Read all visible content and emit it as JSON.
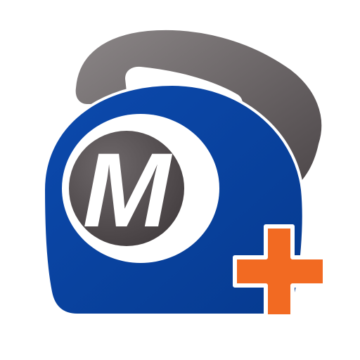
{
  "app_icon": {
    "name": "phone-m-plus-app-icon",
    "monogram": "M",
    "colors": {
      "body_blue": "#0A45A6",
      "body_blue_dark": "#063A8F",
      "ring_white": "#ffffff",
      "disc_dark": "#4A4446",
      "disc_mid": "#6E686A",
      "receiver_light": "#8C8788",
      "receiver_dark": "#4B4547",
      "plus_orange": "#F26A22",
      "plus_outline": "#ffffff"
    }
  }
}
